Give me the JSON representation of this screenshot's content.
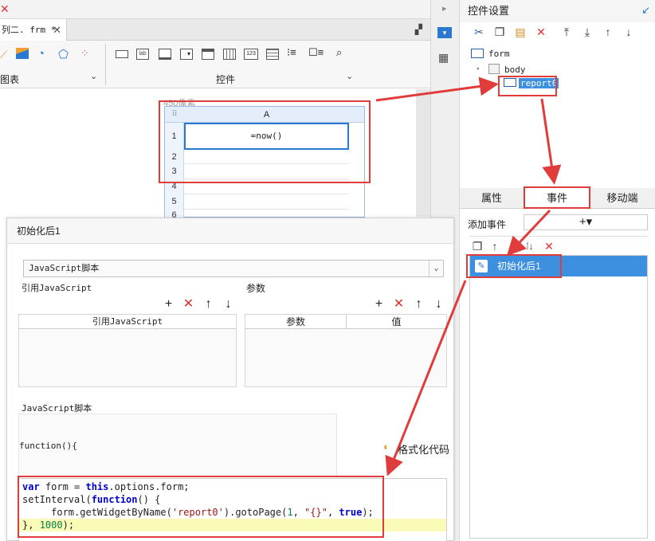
{
  "topbar": {
    "close_glyph": "✕"
  },
  "editor_tab": {
    "label": "列二. frm *",
    "close": "✕"
  },
  "toolbar": {
    "group_left_label": "图表",
    "group_right_label": "控件",
    "chevron": "⌄",
    "icons": [
      "line-chart-icon",
      "area-chart-icon",
      "gauge-icon",
      "radar-chart-icon",
      "scatter-chart-icon",
      "button-widget-icon",
      "label-widget-icon",
      "text-widget-icon",
      "combo-widget-icon",
      "list-widget-icon",
      "date-widget-icon",
      "number-widget-icon",
      "textarea-widget-icon",
      "radio-group-icon",
      "checkbox-group-icon",
      "search-widget-icon"
    ]
  },
  "canvas": {
    "width_label": "450像素",
    "sheet": {
      "column": "A",
      "rows": [
        "1",
        "2",
        "3",
        "4",
        "5",
        "6"
      ],
      "cell_a1": "=now()"
    }
  },
  "right_panel": {
    "title": "控件设置",
    "tree": {
      "root": "form",
      "body": "body",
      "selected": "report0"
    },
    "tabs": [
      "属性",
      "事件",
      "移动端"
    ],
    "add_event_label": "添加事件",
    "add_glyph": "+▾",
    "event_item": "初始化后1"
  },
  "dialog": {
    "title": "初始化后1",
    "script_type": "JavaScript脚本",
    "ref_js_title": "引用JavaScript",
    "ref_js_col": "引用JavaScript",
    "params_title": "参数",
    "params_cols": [
      "参数",
      "值"
    ],
    "script_title": "JavaScript脚本",
    "function_header": "function(){",
    "format_code": "格式化代码",
    "code_lines": [
      "var form = this.options.form;",
      "setInterval(function() {",
      "     form.getWidgetByName('report0').gotoPage(1, \"{}\", true);",
      "}, 1000);"
    ]
  },
  "colors": {
    "selection": "#3d8fe0",
    "highlight_box": "#e03c3c",
    "code_highlight": "#fbfbb8"
  }
}
